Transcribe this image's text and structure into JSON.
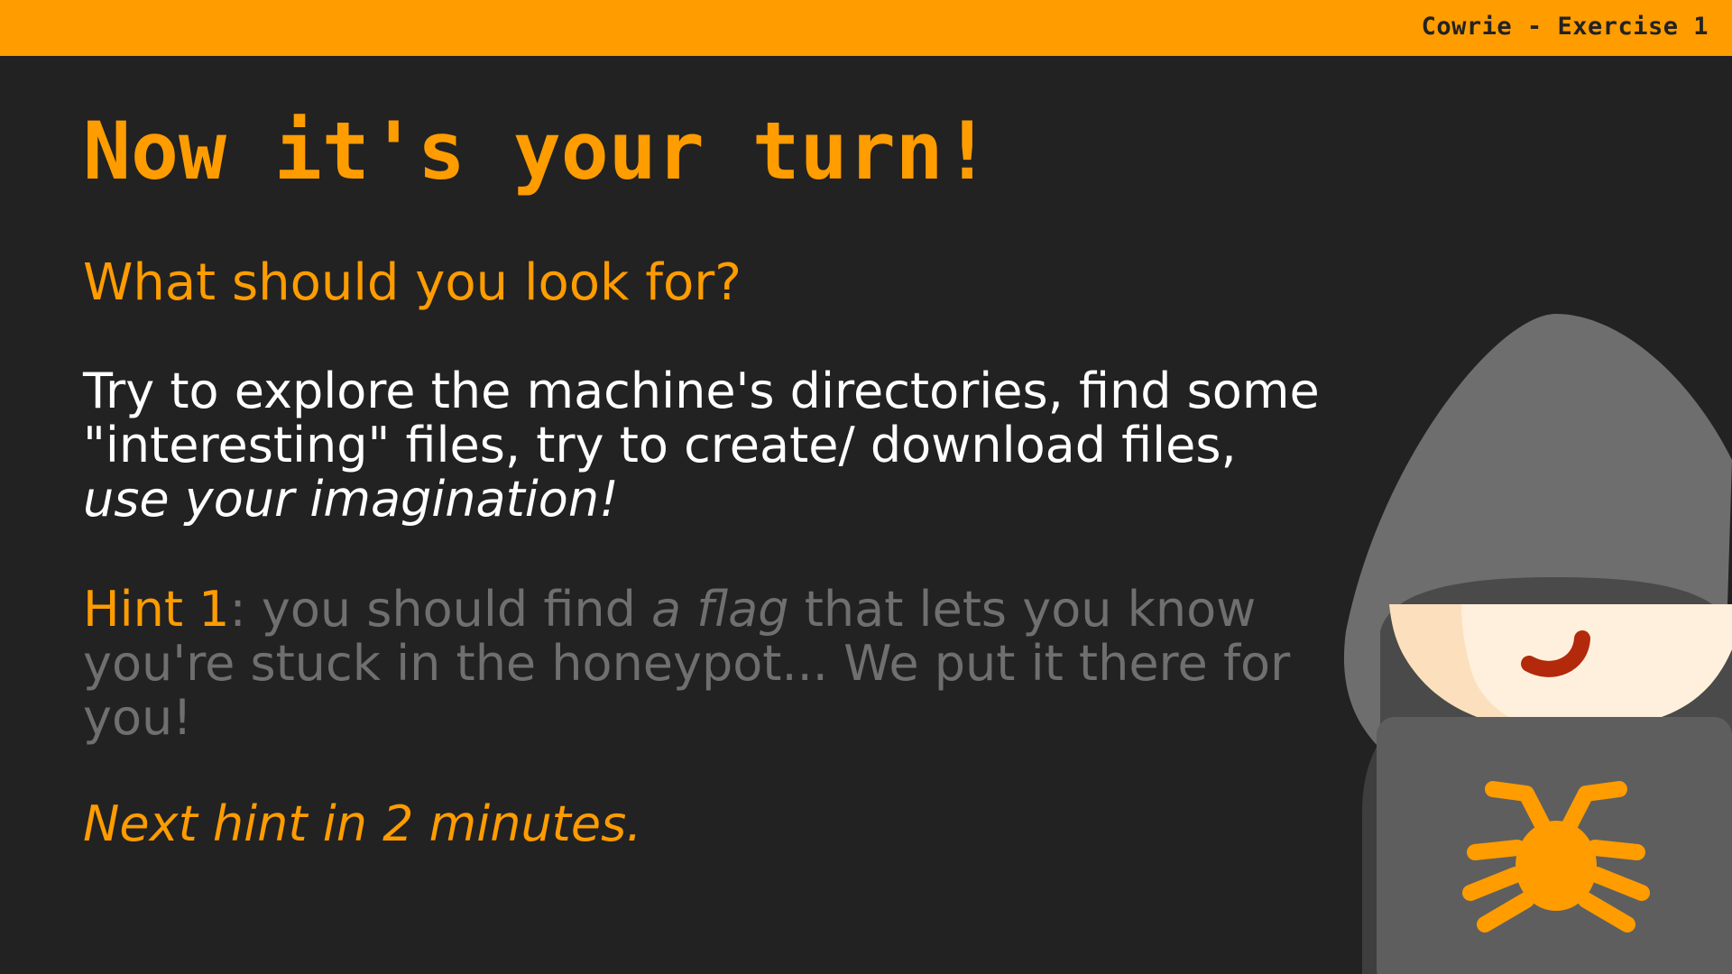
{
  "header": {
    "title": "Cowrie - Exercise 1"
  },
  "slide": {
    "heading": "Now it's your turn!",
    "question": "What should you look for?",
    "body": {
      "text": "Try to explore the machine's directories, find some \"interesting\" files, try to create/ download files, ",
      "emphasis": "use your imagination!"
    },
    "hint": {
      "label": "Hint 1",
      "text_before": ": you should find ",
      "emphasis": "a flag",
      "text_after": " that lets you know you're stuck in the honeypot... We put it there for you!"
    },
    "next_hint": "Next hint in 2 minutes."
  },
  "illustration": {
    "icon": "hooded-hacker-with-bug-laptop-icon"
  },
  "colors": {
    "background": "#222222",
    "accent": "#FF9C00",
    "text": "#FFFFFF",
    "muted_text": "#6F6F6F",
    "hood": "#6E6E6E",
    "laptop": "#5E5E5E"
  }
}
